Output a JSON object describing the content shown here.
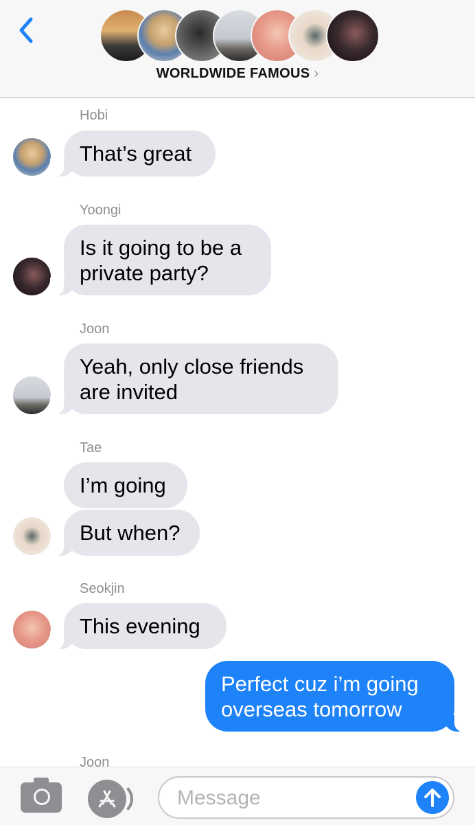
{
  "header": {
    "group_name": "WORLDWIDE FAMOUS",
    "chevron": "›",
    "back_icon": "chevron-left-icon",
    "member_avatar_count": 7
  },
  "colors": {
    "accent": "#1e82f8",
    "incoming_bubble": "#e6e5eb",
    "sender_label": "#8e8e93"
  },
  "messages": [
    {
      "sender": "Hobi",
      "text": "That’s great"
    },
    {
      "sender": "Yoongi",
      "lines": [
        "Is it going to be a",
        "private party?"
      ]
    },
    {
      "sender": "Joon",
      "lines": [
        "Yeah, only close friends",
        "are invited"
      ]
    },
    {
      "sender": "Tae",
      "texts": [
        "I’m going",
        "But when?"
      ]
    },
    {
      "sender": "Seokjin",
      "text": "This evening"
    },
    {
      "sender": "me",
      "lines": [
        "Perfect cuz i’m going",
        "overseas tomorrow"
      ]
    },
    {
      "sender": "Joon",
      "partial": true
    }
  ],
  "composer": {
    "placeholder": "Message",
    "camera_icon": "camera-icon",
    "apps_icon": "app-store-icon",
    "send_icon": "arrow-up-icon"
  }
}
